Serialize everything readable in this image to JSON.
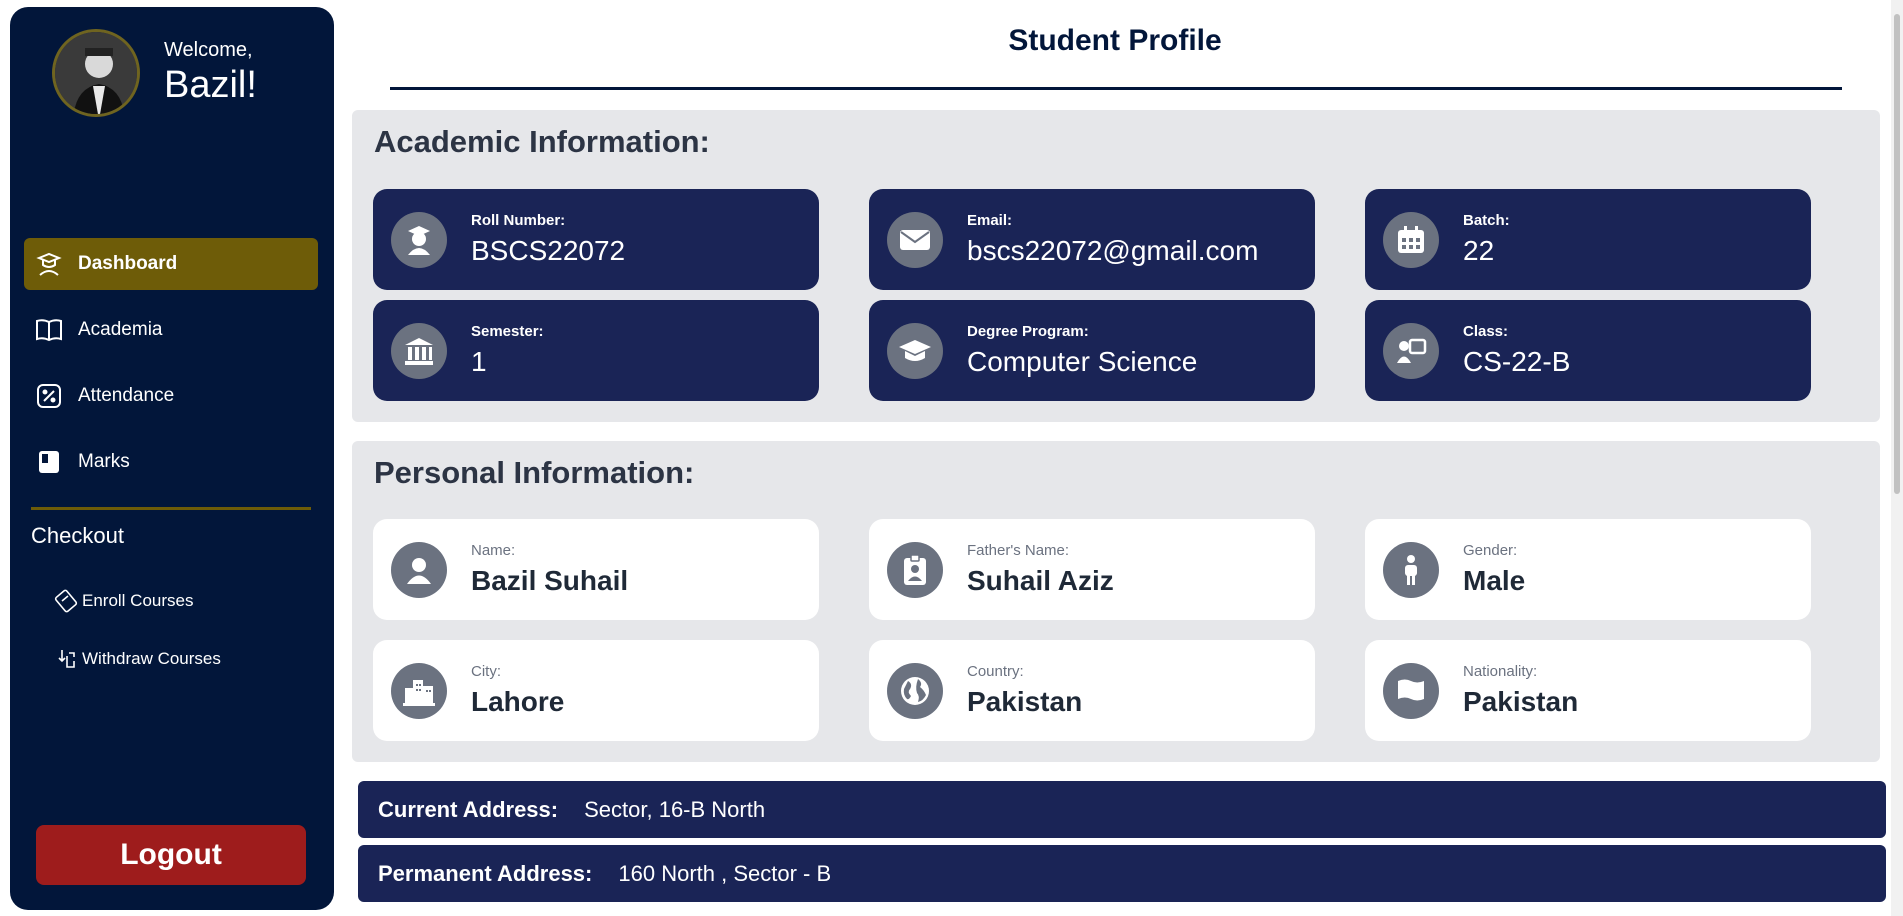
{
  "sidebar": {
    "welcome": "Welcome,",
    "user_name": "Bazil!",
    "nav": [
      {
        "label": "Dashboard",
        "icon": "student-desk-icon",
        "active": true
      },
      {
        "label": "Academia",
        "icon": "book-open-icon",
        "active": false
      },
      {
        "label": "Attendance",
        "icon": "percent-icon",
        "active": false
      },
      {
        "label": "Marks",
        "icon": "report-book-icon",
        "active": false
      }
    ],
    "checkout_label": "Checkout",
    "sub_items": [
      {
        "label": "Enroll Courses",
        "icon": "ticket-icon"
      },
      {
        "label": "Withdraw Courses",
        "icon": "hand-withdraw-icon"
      }
    ],
    "logout_label": "Logout"
  },
  "main": {
    "title": "Student Profile",
    "academic": {
      "heading": "Academic Information:",
      "cards": [
        {
          "label": "Roll Number:",
          "value": "BSCS22072",
          "icon": "student-icon"
        },
        {
          "label": "Email:",
          "value": "bscs22072@gmail.com",
          "icon": "envelope-icon"
        },
        {
          "label": "Batch:",
          "value": "22",
          "icon": "calendar-icon"
        },
        {
          "label": "Semester:",
          "value": "1",
          "icon": "institution-icon"
        },
        {
          "label": "Degree Program:",
          "value": "Computer Science",
          "icon": "graduation-cap-icon"
        },
        {
          "label": "Class:",
          "value": "CS-22-B",
          "icon": "classroom-icon"
        }
      ]
    },
    "personal": {
      "heading": "Personal Information:",
      "cards": [
        {
          "label": "Name:",
          "value": "Bazil Suhail",
          "icon": "user-icon"
        },
        {
          "label": "Father's Name:",
          "value": "Suhail Aziz",
          "icon": "id-badge-icon"
        },
        {
          "label": "Gender:",
          "value": "Male",
          "icon": "person-icon"
        },
        {
          "label": "City:",
          "value": "Lahore",
          "icon": "city-icon"
        },
        {
          "label": "Country:",
          "value": "Pakistan",
          "icon": "globe-icon"
        },
        {
          "label": "Nationality:",
          "value": "Pakistan",
          "icon": "flag-icon"
        }
      ]
    },
    "current_address": {
      "label": "Current Address:",
      "value": "Sector, 16-B North"
    },
    "permanent_address": {
      "label": "Permanent Address:",
      "value": "160 North , Sector - B"
    }
  },
  "colors": {
    "sidebar_bg": "#02163a",
    "active_nav": "#6e5c08",
    "card_dark": "#1a2456",
    "logout": "#9e1c1c",
    "section_bg": "#e6e7ea"
  }
}
